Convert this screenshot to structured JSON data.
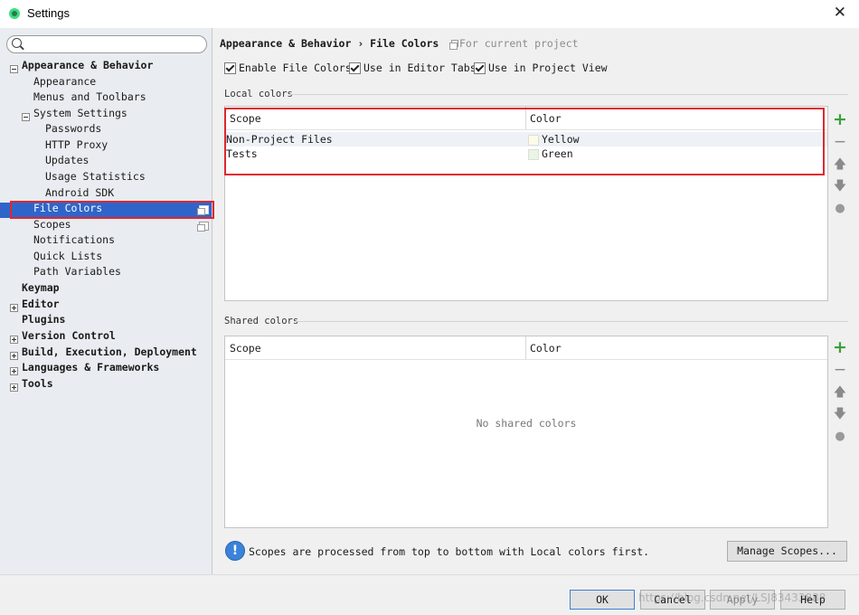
{
  "window": {
    "title": "Settings"
  },
  "sidebar": {
    "search_placeholder": "",
    "tree": [
      {
        "label": "Appearance & Behavior",
        "bold": true,
        "toggle": "minus"
      },
      {
        "label": "Appearance"
      },
      {
        "label": "Menus and Toolbars"
      },
      {
        "label": "System Settings",
        "toggle": "minus"
      },
      {
        "label": "Passwords"
      },
      {
        "label": "HTTP Proxy"
      },
      {
        "label": "Updates"
      },
      {
        "label": "Usage Statistics"
      },
      {
        "label": "Android SDK"
      },
      {
        "label": "File Colors",
        "selected": true
      },
      {
        "label": "Scopes"
      },
      {
        "label": "Notifications"
      },
      {
        "label": "Quick Lists"
      },
      {
        "label": "Path Variables"
      },
      {
        "label": "Keymap",
        "bold": true
      },
      {
        "label": "Editor",
        "bold": true,
        "toggle": "plus"
      },
      {
        "label": "Plugins",
        "bold": true
      },
      {
        "label": "Version Control",
        "bold": true,
        "toggle": "plus"
      },
      {
        "label": "Build, Execution, Deployment",
        "bold": true,
        "toggle": "plus"
      },
      {
        "label": "Languages & Frameworks",
        "bold": true,
        "toggle": "plus"
      },
      {
        "label": "Tools",
        "bold": true,
        "toggle": "plus"
      }
    ]
  },
  "main": {
    "breadcrumb": "Appearance & Behavior › File Colors",
    "breadcrumb_note": "For current project",
    "checkboxes": [
      {
        "label": "Enable File Colors",
        "checked": true
      },
      {
        "label": "Use in Editor Tabs",
        "checked": true
      },
      {
        "label": "Use in Project View",
        "checked": true
      }
    ],
    "local": {
      "section_label": "Local colors",
      "columns": [
        "Scope",
        "Color"
      ],
      "rows": [
        {
          "scope": "Non-Project Files",
          "color": "Yellow",
          "swatch": "#fcfce6"
        },
        {
          "scope": "Tests",
          "color": "Green",
          "swatch": "#e8f6e3"
        }
      ]
    },
    "shared": {
      "section_label": "Shared colors",
      "columns": [
        "Scope",
        "Color"
      ],
      "empty_text": "No shared colors"
    },
    "info_text": "Scopes are processed from top to bottom with Local colors first.",
    "manage_scopes_label": "Manage Scopes..."
  },
  "footer": {
    "ok_label": "OK",
    "cancel_label": "Cancel",
    "apply_label": "Apply",
    "help_label": "Help",
    "watermark": "https://blog.csdn.net/LSJ83433888"
  },
  "colors": {
    "selection": "#2f65ca",
    "highlight_border": "#e0262f",
    "add_icon": "#3aa03a"
  }
}
